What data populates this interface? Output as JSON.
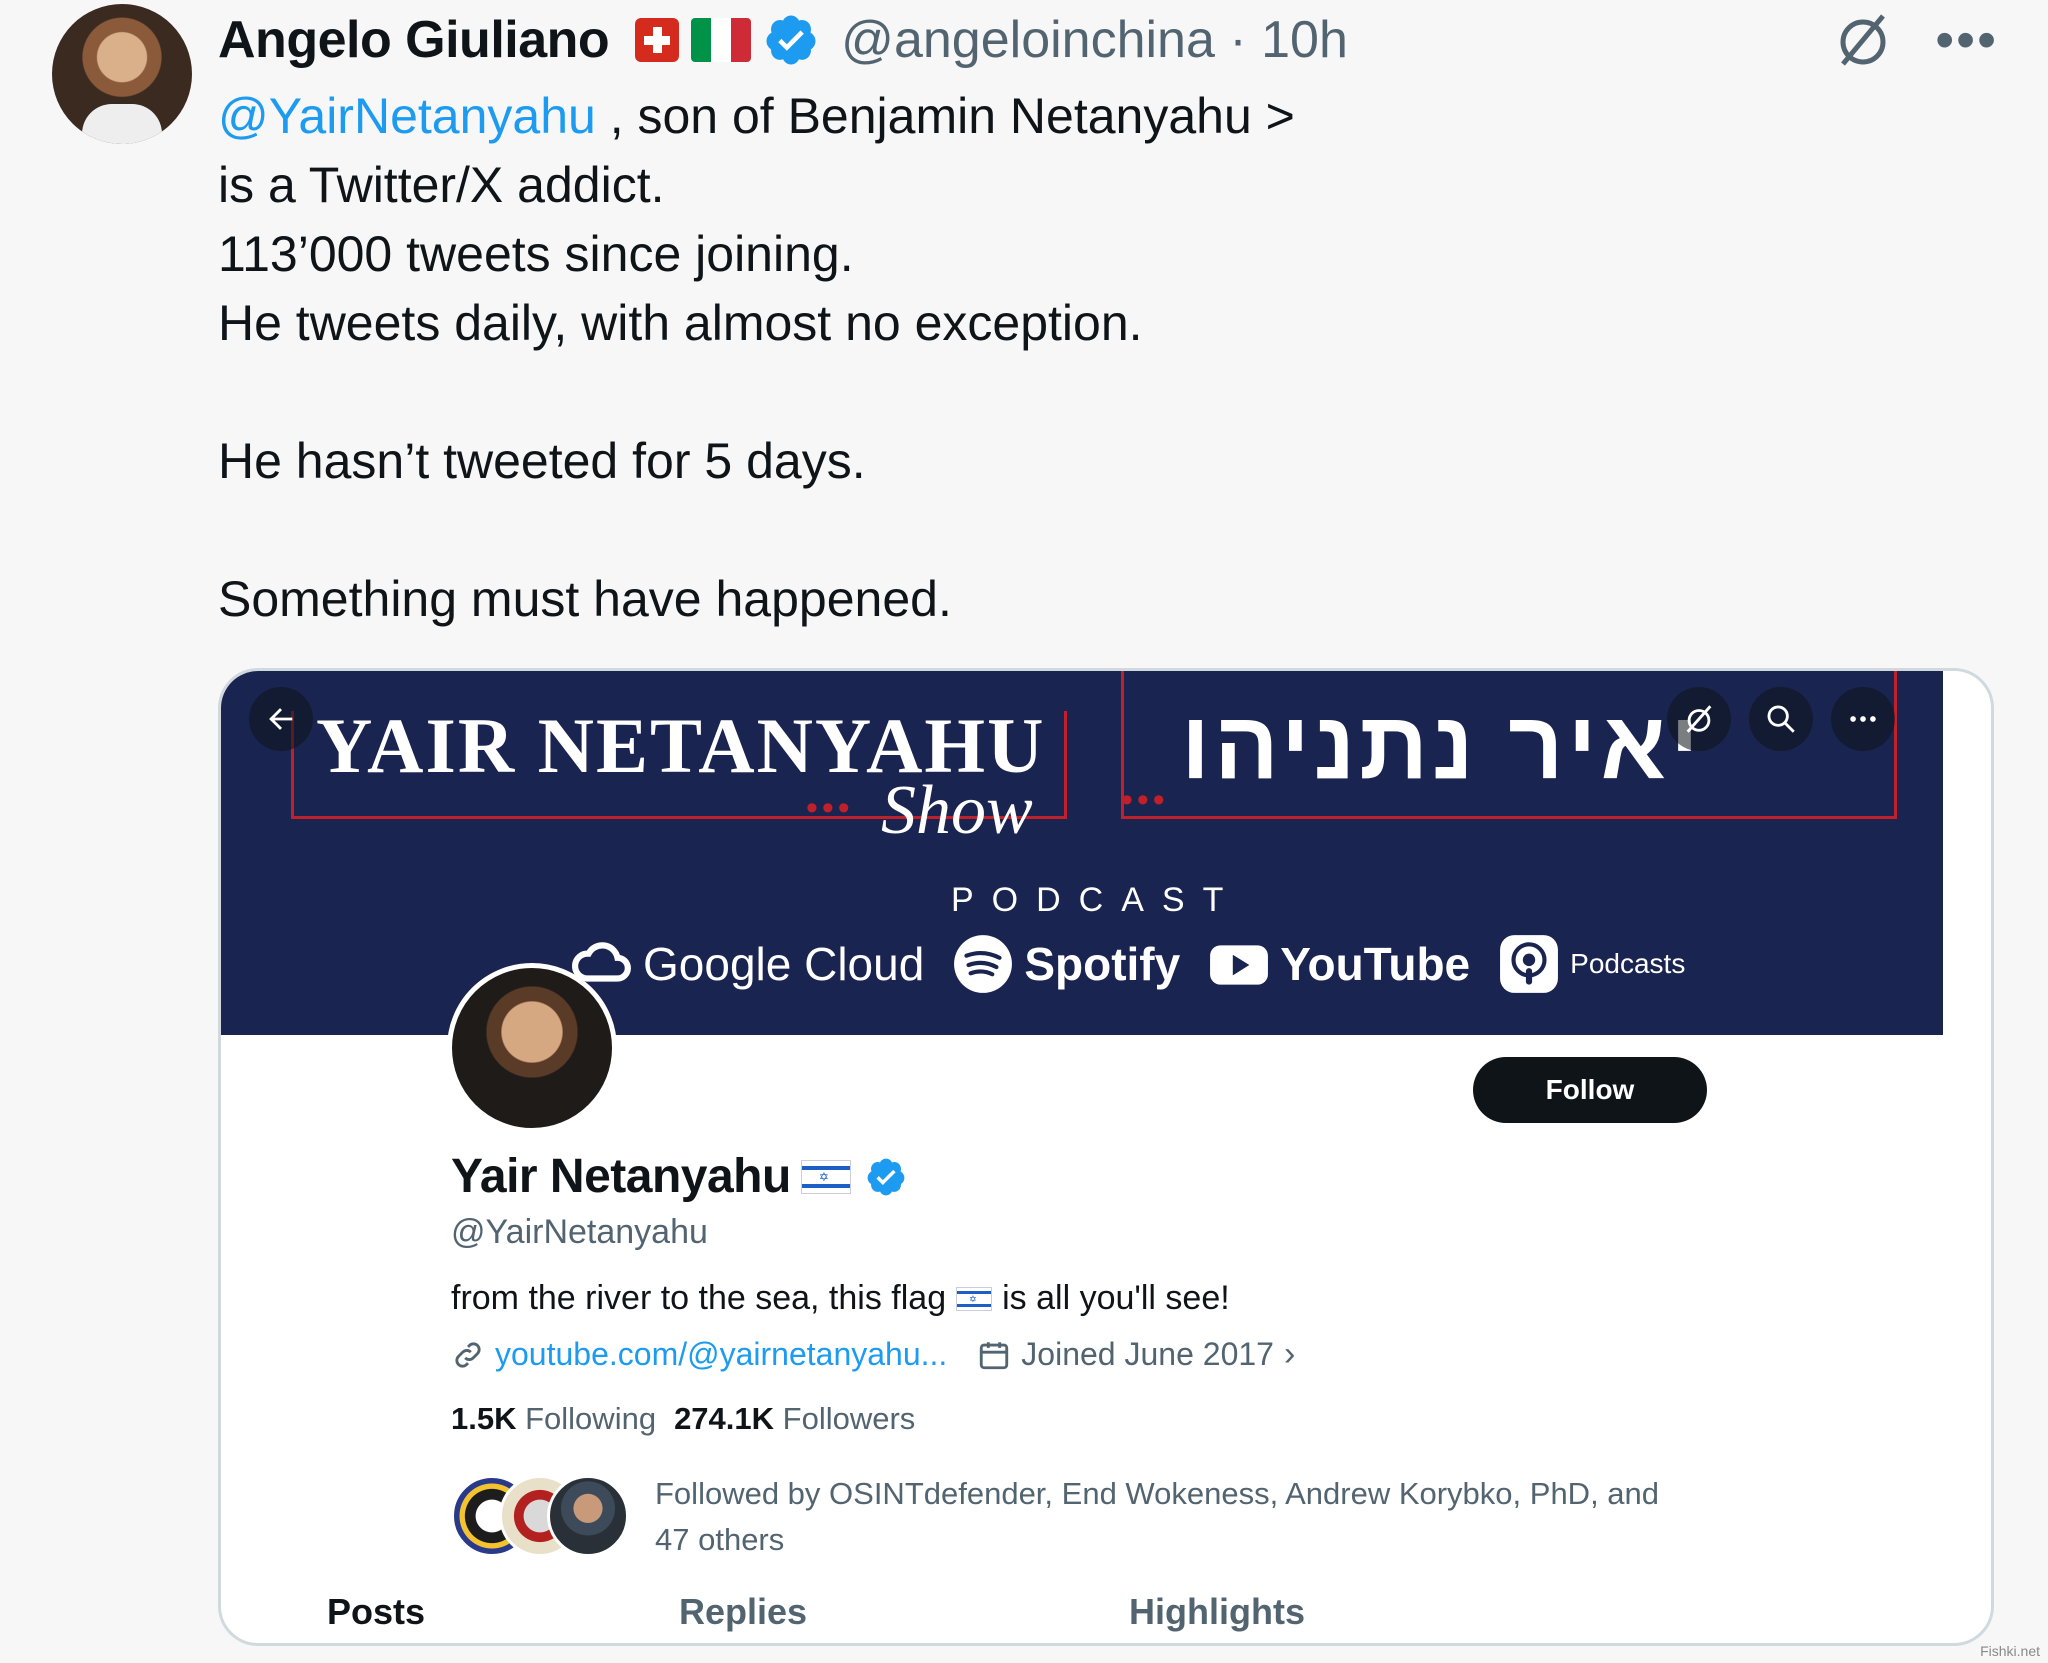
{
  "tweet": {
    "author_name": "Angelo Giuliano",
    "handle_time": "@angeloinchina · 10h",
    "mention": "@YairNetanyahu",
    "text_after_mention": " , son of Benjamin Netanyahu >",
    "text_lines": "is a Twitter/X addict.\n113’000 tweets since joining.\nHe tweets daily, with almost no exception.\n\nHe hasn’t tweeted for 5 days.\n\nSomething must have happened."
  },
  "banner": {
    "title_en": "YAIR NETANYAHU",
    "title_he": "יאיר נתניהו",
    "show": "Show",
    "podcast": "PODCAST",
    "platforms": [
      "Google Cloud",
      "Spotify",
      "YouTube",
      "Podcasts"
    ]
  },
  "profile": {
    "name": "Yair Netanyahu",
    "handle": "@YairNetanyahu",
    "bio_before_flag": "from the river to the sea, this flag",
    "bio_after_flag": "is all you'll see!",
    "link": "youtube.com/@yairnetanyahu...",
    "joined": "Joined June 2017",
    "following_count": "1.5K",
    "following_label": "Following",
    "followers_count": "274.1K",
    "followers_label": "Followers",
    "followed_by": "Followed by OSINTdefender, End Wokeness, Andrew Korybko, PhD, and 47 others",
    "follow_button": "Follow"
  },
  "tabs": [
    "Posts",
    "Replies",
    "Highlights"
  ],
  "watermark": "Fishki.net",
  "colors": {
    "accent": "#1d9bf0",
    "banner_bg": "#1a2450",
    "banner_red": "#c0202a",
    "text": "#0f1419",
    "muted": "#536471"
  }
}
